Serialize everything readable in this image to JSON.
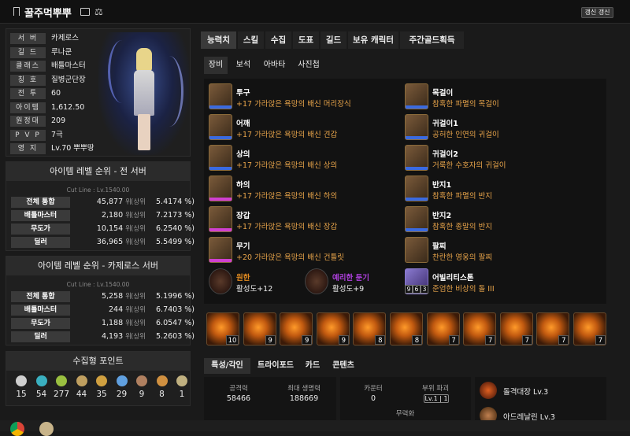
{
  "header": {
    "title": "꿀주먹뿌뿌",
    "refresh_label": "갱신 갱신"
  },
  "profile": {
    "rows": [
      {
        "label": "서 버",
        "value": "카제로스"
      },
      {
        "label": "길 드",
        "value": "루나쿤"
      },
      {
        "label": "클래스",
        "value": "배틀마스터"
      },
      {
        "label": "칭 호",
        "value": "질병군단장"
      },
      {
        "label": "전 투",
        "value": "60"
      },
      {
        "label": "아이템",
        "value": "1,612.50"
      },
      {
        "label": "원정대",
        "value": "209"
      },
      {
        "label": "P V P",
        "value": "7극"
      },
      {
        "label": "영 지",
        "value": "Lv.70 뿌뿌땅"
      }
    ]
  },
  "rank_all": {
    "title": "아이템 레벨 순위 - 전 서버",
    "cutline": "Cut Line : Lv.1540.00",
    "rows": [
      {
        "name": "전체 통합",
        "rank": "45,877",
        "unit": "위",
        "sub": "(상위",
        "pct": "5.4174 %)"
      },
      {
        "name": "배틀마스터",
        "rank": "2,180",
        "unit": "위",
        "sub": "(상위",
        "pct": "7.2173 %)"
      },
      {
        "name": "무도가",
        "rank": "10,154",
        "unit": "위",
        "sub": "(상위",
        "pct": "6.2540 %)"
      },
      {
        "name": "딜러",
        "rank": "36,965",
        "unit": "위",
        "sub": "(상위",
        "pct": "5.5499 %)"
      }
    ]
  },
  "rank_server": {
    "title": "아이템 레벨 순위 - 카제로스 서버",
    "cutline": "Cut Line : Lv.1540.00",
    "rows": [
      {
        "name": "전체 통합",
        "rank": "5,258",
        "unit": "위",
        "sub": "(상위",
        "pct": "5.1996 %)"
      },
      {
        "name": "배틀마스터",
        "rank": "244",
        "unit": "위",
        "sub": "(상위",
        "pct": "6.7403 %)"
      },
      {
        "name": "무도가",
        "rank": "1,188",
        "unit": "위",
        "sub": "(상위",
        "pct": "6.0547 %)"
      },
      {
        "name": "딜러",
        "rank": "4,193",
        "unit": "위",
        "sub": "(상위",
        "pct": "5.2603 %)"
      }
    ]
  },
  "collect": {
    "title": "수집형 포인트",
    "items": [
      {
        "icon": "mokoko-seed-icon",
        "value": "15",
        "color": "#cfcfcf"
      },
      {
        "icon": "island-heart-icon",
        "value": "54",
        "color": "#3ab0c0"
      },
      {
        "icon": "giant-heart-icon",
        "value": "277",
        "color": "#9ac040"
      },
      {
        "icon": "art-icon",
        "value": "44",
        "color": "#c0a060"
      },
      {
        "icon": "adventure-tome-icon",
        "value": "35",
        "color": "#d0a040"
      },
      {
        "icon": "world-tree-leaf-icon",
        "value": "29",
        "color": "#60a0e0"
      },
      {
        "icon": "ignea-token-icon",
        "value": "9",
        "color": "#b08060"
      },
      {
        "icon": "orpheus-star-icon",
        "value": "8",
        "color": "#d09040"
      },
      {
        "icon": "sea-bounty-icon",
        "value": "1",
        "color": "#c0b080"
      }
    ]
  },
  "tabs": [
    "능력치",
    "스킬",
    "수집",
    "도표",
    "길드",
    "보유 캐릭터",
    "주간골드획득"
  ],
  "subtabs": [
    "장비",
    "보석",
    "아바타",
    "사진첩"
  ],
  "equip_left": [
    {
      "name": "투구",
      "desc": "+17 가라앉은 욕망의 배신 머리장식",
      "bar": "#3a6ae0"
    },
    {
      "name": "어깨",
      "desc": "+17 가라앉은 욕망의 배신 견갑",
      "bar": "#3a6ae0"
    },
    {
      "name": "상의",
      "desc": "+17 가라앉은 욕망의 배신 상의",
      "bar": "#3a6ae0"
    },
    {
      "name": "하의",
      "desc": "+17 가라앉은 욕망의 배신 하의",
      "bar": "#d040d0"
    },
    {
      "name": "장갑",
      "desc": "+17 가라앉은 욕망의 배신 장갑",
      "bar": "#d040d0"
    },
    {
      "name": "무기",
      "desc": "+20 가라앉은 욕망의 배신 건틀릿",
      "bar": "#d040d0"
    }
  ],
  "equip_right": [
    {
      "name": "목걸이",
      "desc": "참혹한 파멸의 목걸이",
      "bar": "#3a6ae0"
    },
    {
      "name": "귀걸이1",
      "desc": "공허한 인연의 귀걸이",
      "bar": "#3a6ae0"
    },
    {
      "name": "귀걸이2",
      "desc": "거룩한 수호자의 귀걸이",
      "bar": "#3a6ae0"
    },
    {
      "name": "반지1",
      "desc": "참혹한 파멸의 반지",
      "bar": "#3a6ae0"
    },
    {
      "name": "반지2",
      "desc": "참혹한 종말의 반지",
      "bar": "#3a6ae0"
    },
    {
      "name": "팔찌",
      "desc": "찬란한 영웅의 팔찌",
      "bar": ""
    }
  ],
  "extras": [
    {
      "name": "원한",
      "sub": "활성도+12",
      "color": "#e08a20"
    },
    {
      "name": "예리한 둔기",
      "sub": "활성도+9",
      "color": "#b040e0"
    },
    {
      "name": "어빌리티스톤",
      "sub": "준엄한 비상의 돌 III",
      "stone": [
        "9",
        "6",
        "3"
      ]
    }
  ],
  "gems": [
    "10",
    "9",
    "9",
    "9",
    "8",
    "8",
    "7",
    "7",
    "7",
    "7",
    "7"
  ],
  "tabs3": [
    "특성/각인",
    "트라이포드",
    "카드",
    "콘텐츠"
  ],
  "stats": {
    "attack_label": "공격력",
    "attack": "58466",
    "hp_label": "최대 생명력",
    "hp": "188669",
    "counter_label": "카운터",
    "counter": "0",
    "part_label": "부위 파괴",
    "part": "Lv.1 | 1",
    "neutral_label": "무력화",
    "skills": [
      "돌격대장 Lv.3",
      "아드레날린 Lv.3"
    ]
  }
}
